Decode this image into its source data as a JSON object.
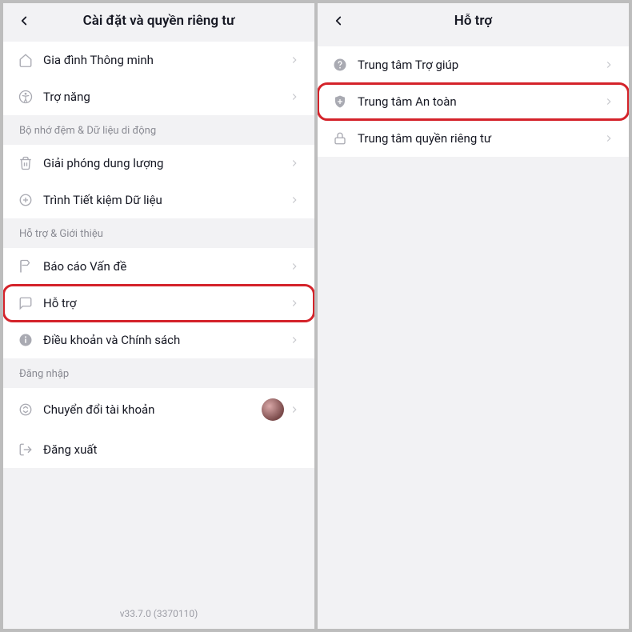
{
  "left": {
    "title": "Cài đặt và quyền riêng tư",
    "group1": [
      {
        "label": "Gia đình Thông minh",
        "icon": "home"
      },
      {
        "label": "Trợ năng",
        "icon": "accessibility"
      }
    ],
    "section_cache": "Bộ nhớ đệm & Dữ liệu di động",
    "group2": [
      {
        "label": "Giải phóng dung lượng",
        "icon": "trash"
      },
      {
        "label": "Trình Tiết kiệm Dữ liệu",
        "icon": "datasaver"
      }
    ],
    "section_support": "Hỗ trợ & Giới thiệu",
    "group3": [
      {
        "label": "Báo cáo Vấn đề",
        "icon": "flag"
      },
      {
        "label": "Hỗ trợ",
        "icon": "chat",
        "highlight": true
      },
      {
        "label": "Điều khoản và Chính sách",
        "icon": "info"
      }
    ],
    "section_login": "Đăng nhập",
    "group4": [
      {
        "label": "Chuyển đổi tài khoản",
        "icon": "switch",
        "avatar": true
      },
      {
        "label": "Đăng xuất",
        "icon": "logout",
        "nochev": true
      }
    ],
    "version": "v33.7.0 (3370110)"
  },
  "right": {
    "title": "Hỗ trợ",
    "items": [
      {
        "label": "Trung tâm Trợ giúp",
        "icon": "help"
      },
      {
        "label": "Trung tâm An toàn",
        "icon": "shield",
        "highlight": true
      },
      {
        "label": "Trung tâm quyền riêng tư",
        "icon": "lock"
      }
    ]
  }
}
